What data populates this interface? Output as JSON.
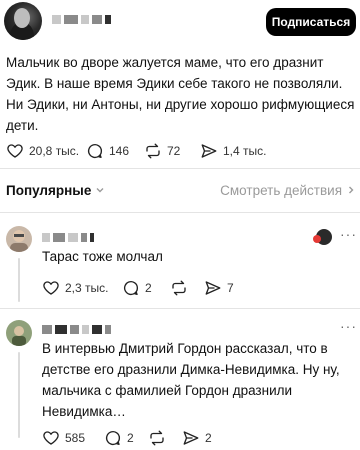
{
  "header": {
    "subscribe_label": "Подписаться"
  },
  "post": {
    "text": "Мальчик во дворе жалуется маме, что его дразнит Эдик. В наше время Эдики себе такого не позволяли. Ни Эдики, ни Антоны, ни другие хорошо рифмующиеся дети.",
    "likes": "20,8 тыс.",
    "comments": "146",
    "reposts": "72",
    "shares": "1,4 тыс."
  },
  "sort": {
    "label": "Популярные",
    "view_activity": "Смотреть действия"
  },
  "comments": [
    {
      "text": "Тарас тоже молчал",
      "likes": "2,3 тыс.",
      "replies": "2",
      "reposts": "",
      "shares": "7"
    },
    {
      "text": "В интервью Дмитрий Гордон рассказал, что в детстве его дразнили Димка-Невидимка. Ну ну, мальчика с фамилией Гордон дразнили Невидимка…",
      "likes": "585",
      "replies": "2",
      "reposts": "",
      "shares": "2"
    }
  ],
  "icons": [
    "heart-icon",
    "comment-icon",
    "repost-icon",
    "share-icon",
    "chevron-down-icon",
    "chevron-right-icon",
    "more-icon"
  ],
  "colors": {
    "button_bg": "#000000",
    "muted": "#9a9a9a",
    "divider": "#e4e4e4"
  }
}
